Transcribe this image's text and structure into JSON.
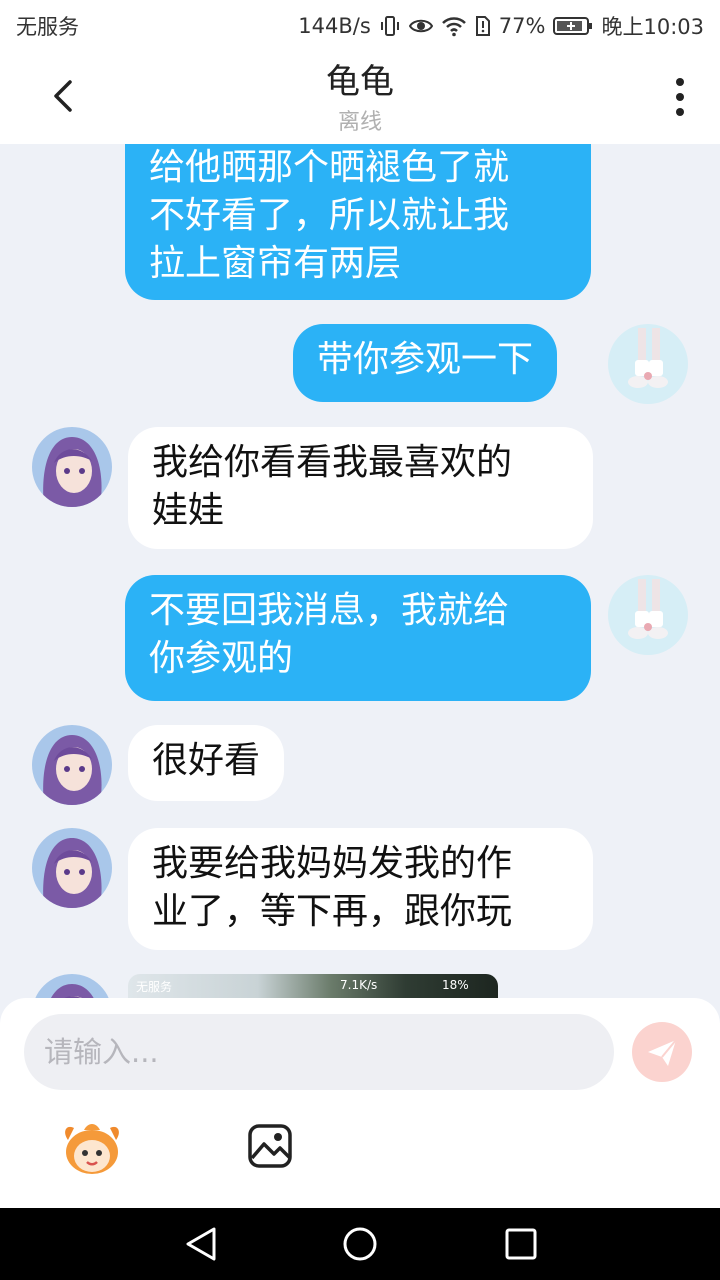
{
  "status_bar": {
    "carrier": "无服务",
    "speed": "144B/s",
    "battery": "77%",
    "time": "晚上10:03"
  },
  "header": {
    "title": "龟龟",
    "subtitle": "离线"
  },
  "messages": [
    {
      "dir": "out",
      "text_lines": [
        "给他晒那个晒褪色了就",
        "不好看了，所以就让我",
        "拉上窗帘有两层"
      ]
    },
    {
      "dir": "out",
      "text": "带你参观一下"
    },
    {
      "dir": "in",
      "text_lines": [
        "我给你看看我最喜欢的",
        "娃娃"
      ]
    },
    {
      "dir": "out",
      "text_lines": [
        "不要回我消息，我就给",
        "你参观的"
      ]
    },
    {
      "dir": "in",
      "text": "很好看"
    },
    {
      "dir": "in",
      "text_lines": [
        "我要给我妈妈发我的作",
        "业了，等下再，跟你玩"
      ]
    },
    {
      "dir": "in",
      "type": "image",
      "inner_status": {
        "carrier": "无服务",
        "speed": "7.1K/s",
        "battery": "18%"
      }
    }
  ],
  "input": {
    "placeholder": "请输入..."
  },
  "colors": {
    "outgoing_bubble": "#2bb2f6",
    "incoming_bubble": "#ffffff",
    "chat_background": "#eef1f7",
    "send_button": "#fbd3cf"
  },
  "icons": [
    "back-arrow-icon",
    "more-vertical-icon",
    "send-icon",
    "emoji-mascot-icon",
    "image-icon",
    "nav-back-icon",
    "nav-home-icon",
    "nav-recent-icon"
  ]
}
